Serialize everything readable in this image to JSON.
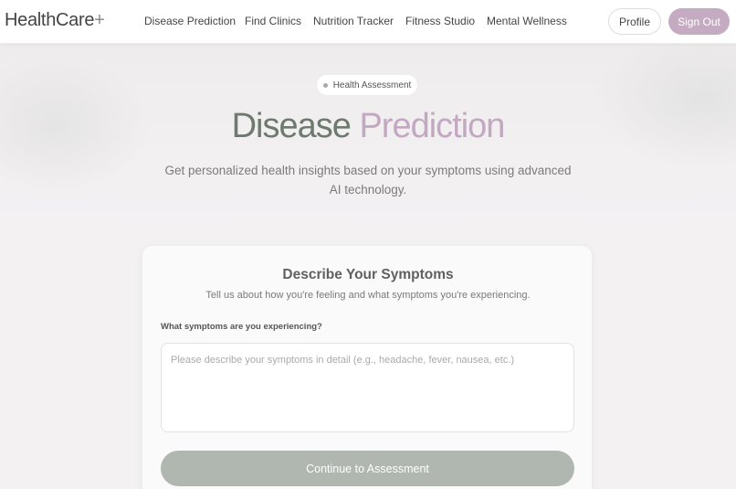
{
  "nav": {
    "brand": "HealthCare",
    "brand_suffix": "+",
    "links": [
      "Disease Prediction",
      "Find Clinics",
      "Nutrition Tracker",
      "Fitness Studio",
      "Mental Wellness"
    ],
    "profile_label": "Profile",
    "signout_label": "Sign Out"
  },
  "hero": {
    "badge": "Health Assessment",
    "title_main": "Disease",
    "title_accent": "Prediction",
    "subtitle": "Get personalized health insights based on your symptoms using advanced AI technology."
  },
  "form": {
    "title": "Describe Your Symptoms",
    "subtitle": "Tell us about how you're feeling and what symptoms you're experiencing.",
    "field_label": "What symptoms are you experiencing?",
    "input_value": "",
    "input_placeholder": "Please describe your symptoms in detail (e.g., headache, fever, nausea, etc.)",
    "submit_label": "Continue to Assessment"
  },
  "colors": {
    "accent": "#c4abc2",
    "title_green": "#6e7a6e",
    "button_gray": "#b0b6b0"
  }
}
